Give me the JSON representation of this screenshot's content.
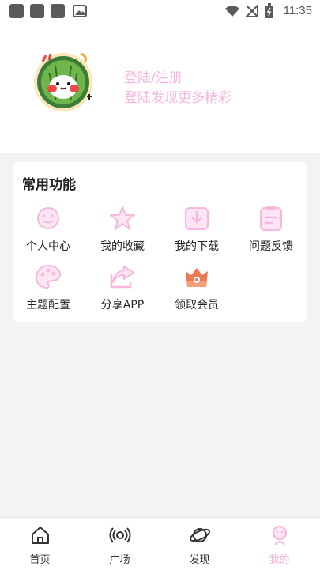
{
  "status_bar": {
    "time": "11:35"
  },
  "profile": {
    "login_label": "登陆/注册",
    "login_hint": "登陆发现更多精彩"
  },
  "functions": {
    "title": "常用功能",
    "items": [
      {
        "label": "个人中心",
        "icon": "smiley-icon"
      },
      {
        "label": "我的收藏",
        "icon": "star-icon"
      },
      {
        "label": "我的下载",
        "icon": "download-icon"
      },
      {
        "label": "问题反馈",
        "icon": "clipboard-icon"
      },
      {
        "label": "主题配置",
        "icon": "palette-icon"
      },
      {
        "label": "分享APP",
        "icon": "share-icon"
      },
      {
        "label": "领取会员",
        "icon": "crown-icon"
      }
    ]
  },
  "tabs": [
    {
      "label": "首页",
      "icon": "home-icon"
    },
    {
      "label": "广场",
      "icon": "broadcast-icon"
    },
    {
      "label": "发现",
      "icon": "planet-icon"
    },
    {
      "label": "我的",
      "icon": "user-icon",
      "active": true
    }
  ],
  "colors": {
    "accent_pink": "#f2b5da",
    "background": "#f3f3f3"
  }
}
